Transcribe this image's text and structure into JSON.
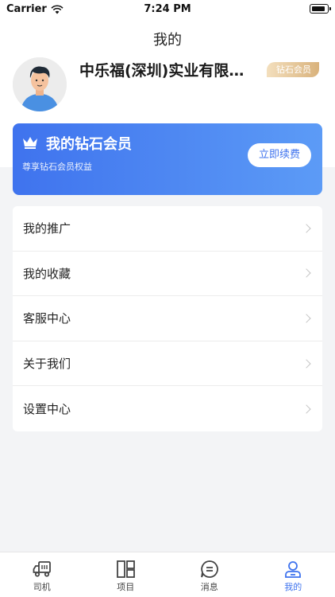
{
  "status_bar": {
    "carrier": "Carrier",
    "time": "7:24 PM"
  },
  "header": {
    "title": "我的"
  },
  "profile": {
    "company_name": "中乐福(深圳)实业有限公司",
    "badge": "钻石会员"
  },
  "membership": {
    "title": "我的钻石会员",
    "subtitle": "尊享钻石会员权益",
    "renew_label": "立即续费"
  },
  "menu": {
    "items": [
      {
        "label": "我的推广"
      },
      {
        "label": "我的收藏"
      },
      {
        "label": "客服中心"
      },
      {
        "label": "关于我们"
      },
      {
        "label": "设置中心"
      }
    ]
  },
  "tabs": [
    {
      "label": "司机",
      "icon": "truck-icon"
    },
    {
      "label": "项目",
      "icon": "layout-icon"
    },
    {
      "label": "消息",
      "icon": "message-icon"
    },
    {
      "label": "我的",
      "icon": "user-icon"
    }
  ],
  "active_tab": "我的",
  "colors": {
    "accent": "#3f73ee",
    "badge_gold": "#d9b27c"
  }
}
